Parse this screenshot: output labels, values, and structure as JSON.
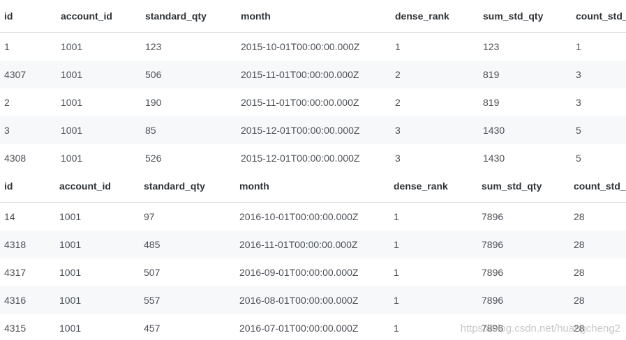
{
  "columns": [
    "id",
    "account_id",
    "standard_qty",
    "month",
    "dense_rank",
    "sum_std_qty",
    "count_std_q"
  ],
  "table_1": {
    "rows": [
      [
        "1",
        "1001",
        "123",
        "2015-10-01T00:00:00.000Z",
        "1",
        "123",
        "1"
      ],
      [
        "4307",
        "1001",
        "506",
        "2015-11-01T00:00:00.000Z",
        "2",
        "819",
        "3"
      ],
      [
        "2",
        "1001",
        "190",
        "2015-11-01T00:00:00.000Z",
        "2",
        "819",
        "3"
      ],
      [
        "3",
        "1001",
        "85",
        "2015-12-01T00:00:00.000Z",
        "3",
        "1430",
        "5"
      ],
      [
        "4308",
        "1001",
        "526",
        "2015-12-01T00:00:00.000Z",
        "3",
        "1430",
        "5"
      ]
    ]
  },
  "table_2": {
    "rows": [
      [
        "14",
        "1001",
        "97",
        "2016-10-01T00:00:00.000Z",
        "1",
        "7896",
        "28"
      ],
      [
        "4318",
        "1001",
        "485",
        "2016-11-01T00:00:00.000Z",
        "1",
        "7896",
        "28"
      ],
      [
        "4317",
        "1001",
        "507",
        "2016-09-01T00:00:00.000Z",
        "1",
        "7896",
        "28"
      ],
      [
        "4316",
        "1001",
        "557",
        "2016-08-01T00:00:00.000Z",
        "1",
        "7896",
        "28"
      ],
      [
        "4315",
        "1001",
        "457",
        "2016-07-01T00:00:00.000Z",
        "1",
        "7896",
        "28"
      ]
    ]
  },
  "watermark": "https://blog.csdn.net/huangcheng2"
}
